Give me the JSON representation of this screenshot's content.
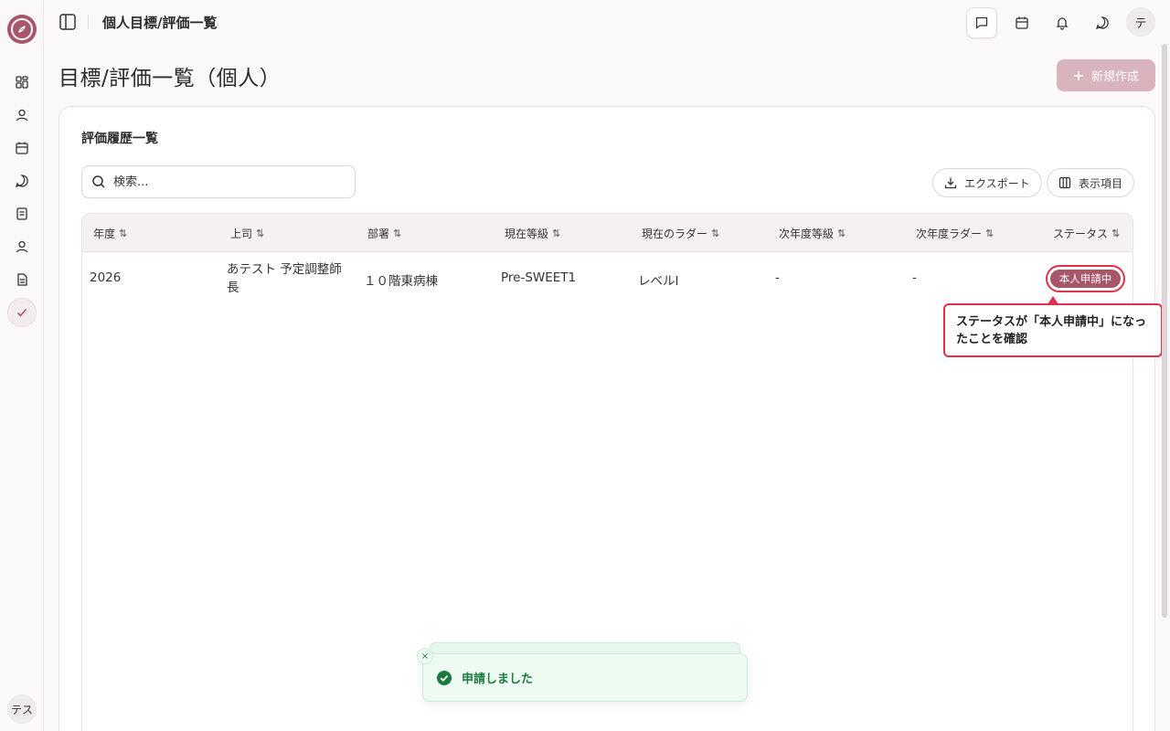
{
  "topbar": {
    "title": "個人目標/評価一覧",
    "avatar": "テ"
  },
  "sidebar": {
    "user_avatar": "テス",
    "items": [
      "dashboard-icon",
      "user-icon",
      "calendar-icon",
      "chat-icon",
      "list-icon",
      "profile-icon",
      "document-icon",
      "check-icon"
    ]
  },
  "page": {
    "title": "目標/評価一覧（個人）",
    "new_button": "新規作成"
  },
  "card": {
    "title": "評価履歴一覧",
    "search_placeholder": "検索...",
    "export_button": "エクスポート",
    "columns_button": "表示項目"
  },
  "table": {
    "headers": [
      "年度",
      "上司",
      "部署",
      "現在等級",
      "現在のラダー",
      "次年度等級",
      "次年度ラダー",
      "ステータス"
    ],
    "sort_glyph": "⇅",
    "rows": [
      {
        "year": "2026",
        "boss": "あテスト 予定調整師長",
        "dept": "１０階東病棟",
        "grade": "Pre-SWEET1",
        "ladder": "レベルI",
        "next_grade": "-",
        "next_ladder": "-",
        "status": "本人申請中"
      }
    ]
  },
  "callout": {
    "text": "ステータスが「本人申請中」になったことを確認"
  },
  "toast": {
    "message": "申請しました",
    "close": "×"
  },
  "colors": {
    "accent": "#a8566a",
    "highlight": "#e0304a",
    "success": "#1c7a3e"
  }
}
